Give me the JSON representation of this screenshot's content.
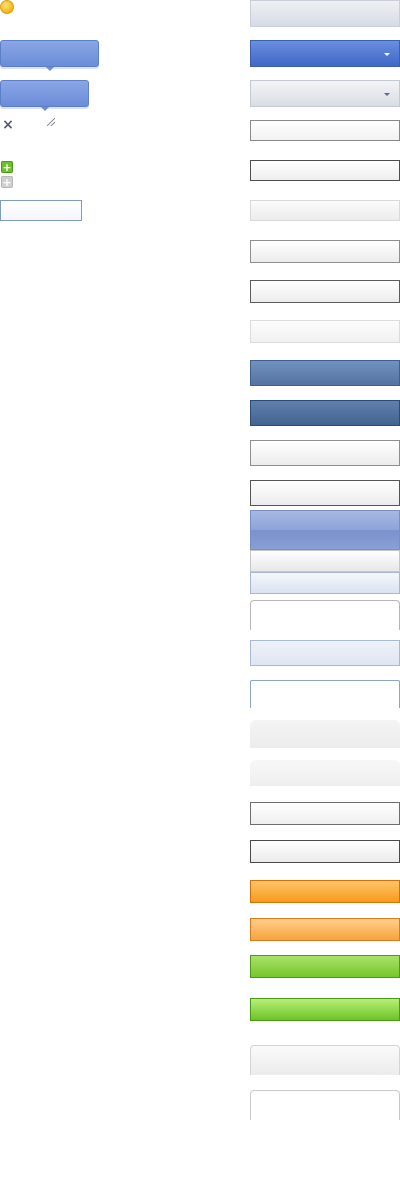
{
  "icons": {
    "info": "info-icon",
    "close": "close-icon",
    "resize": "resize-grip-icon",
    "add": "plus-icon",
    "add_disabled": "plus-disabled-icon",
    "dropdown": "chevron-down-icon"
  },
  "colors": {
    "info_yellow": "#f2b416",
    "tooltip_blue": "#6b8cd8",
    "combo_blue": "#3f68c6",
    "button_blue": "#55739f",
    "header_blue": "#8fa3d8",
    "orange": "#f89a1c",
    "green": "#76c62a",
    "field_border": "#8a8a8a"
  }
}
